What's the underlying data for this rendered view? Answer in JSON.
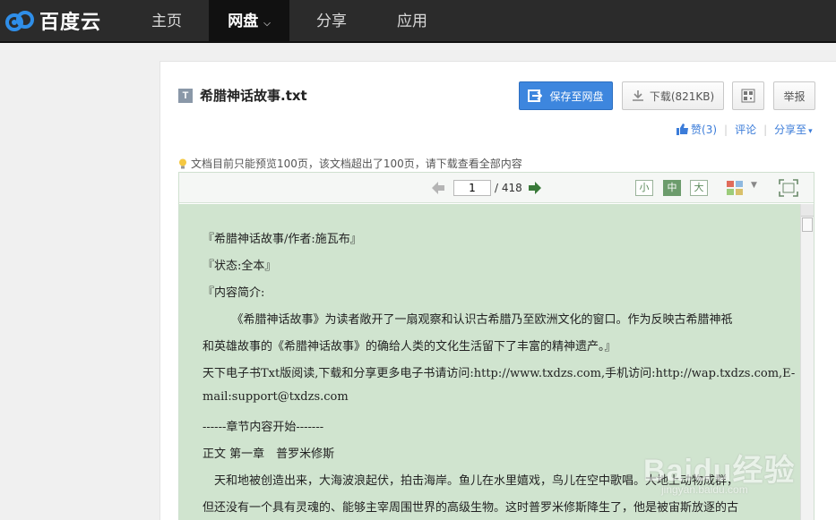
{
  "brand": {
    "name": "百度云"
  },
  "nav": [
    {
      "label": "主页"
    },
    {
      "label": "网盘"
    },
    {
      "label": "分享"
    },
    {
      "label": "应用"
    }
  ],
  "file": {
    "type_icon": "T",
    "title": "希腊神话故事.txt"
  },
  "actions": {
    "save_label": "保存至网盘",
    "download_label": "下载(821KB)",
    "report_label": "举报"
  },
  "social": {
    "like_label": "赞",
    "like_count": "(3)",
    "comment_label": "评论",
    "share_label": "分享至"
  },
  "notice": "文档目前只能预览100页，该文档超出了100页，请下载查看全部内容",
  "viewer": {
    "current_page": "1",
    "total_pages": "/ 418",
    "size_small": "小",
    "size_medium": "中",
    "size_large": "大"
  },
  "document_lines": [
    "『希腊神话故事/作者:施瓦布』",
    "『状态:全本』",
    "『内容简介:",
    "　　　《希腊神话故事》为读者敞开了一扇观察和认识古希腊乃至欧洲文化的窗口。作为反映古希腊神祇",
    "和英雄故事的《希腊神话故事》的确给人类的文化生活留下了丰富的精神遗产。』",
    "天下电子书Txt版阅读,下载和分享更多电子书请访问:http://www.txdzs.com,手机访问:http://wap.txdzs.com,E-",
    "mail:support@txdzs.com",
    "------章节内容开始-------",
    "正文 第一章　普罗米修斯",
    "　天和地被创造出来，大海波浪起伏，拍击海岸。鱼儿在水里嬉戏，鸟儿在空中歌唱。大地上动物成群，",
    "但还没有一个具有灵魂的、能够主宰周围世界的高级生物。这时普罗米修斯降生了，他是被宙斯放逐的古"
  ],
  "watermark": {
    "text": "Baidu经验",
    "sub": "jingyan.baidu.com"
  },
  "colors": {
    "topbar": "#2b2b2b",
    "save_button": "#3d86de",
    "doc_background": "#d0e4cf",
    "link": "#3b7cd9"
  }
}
